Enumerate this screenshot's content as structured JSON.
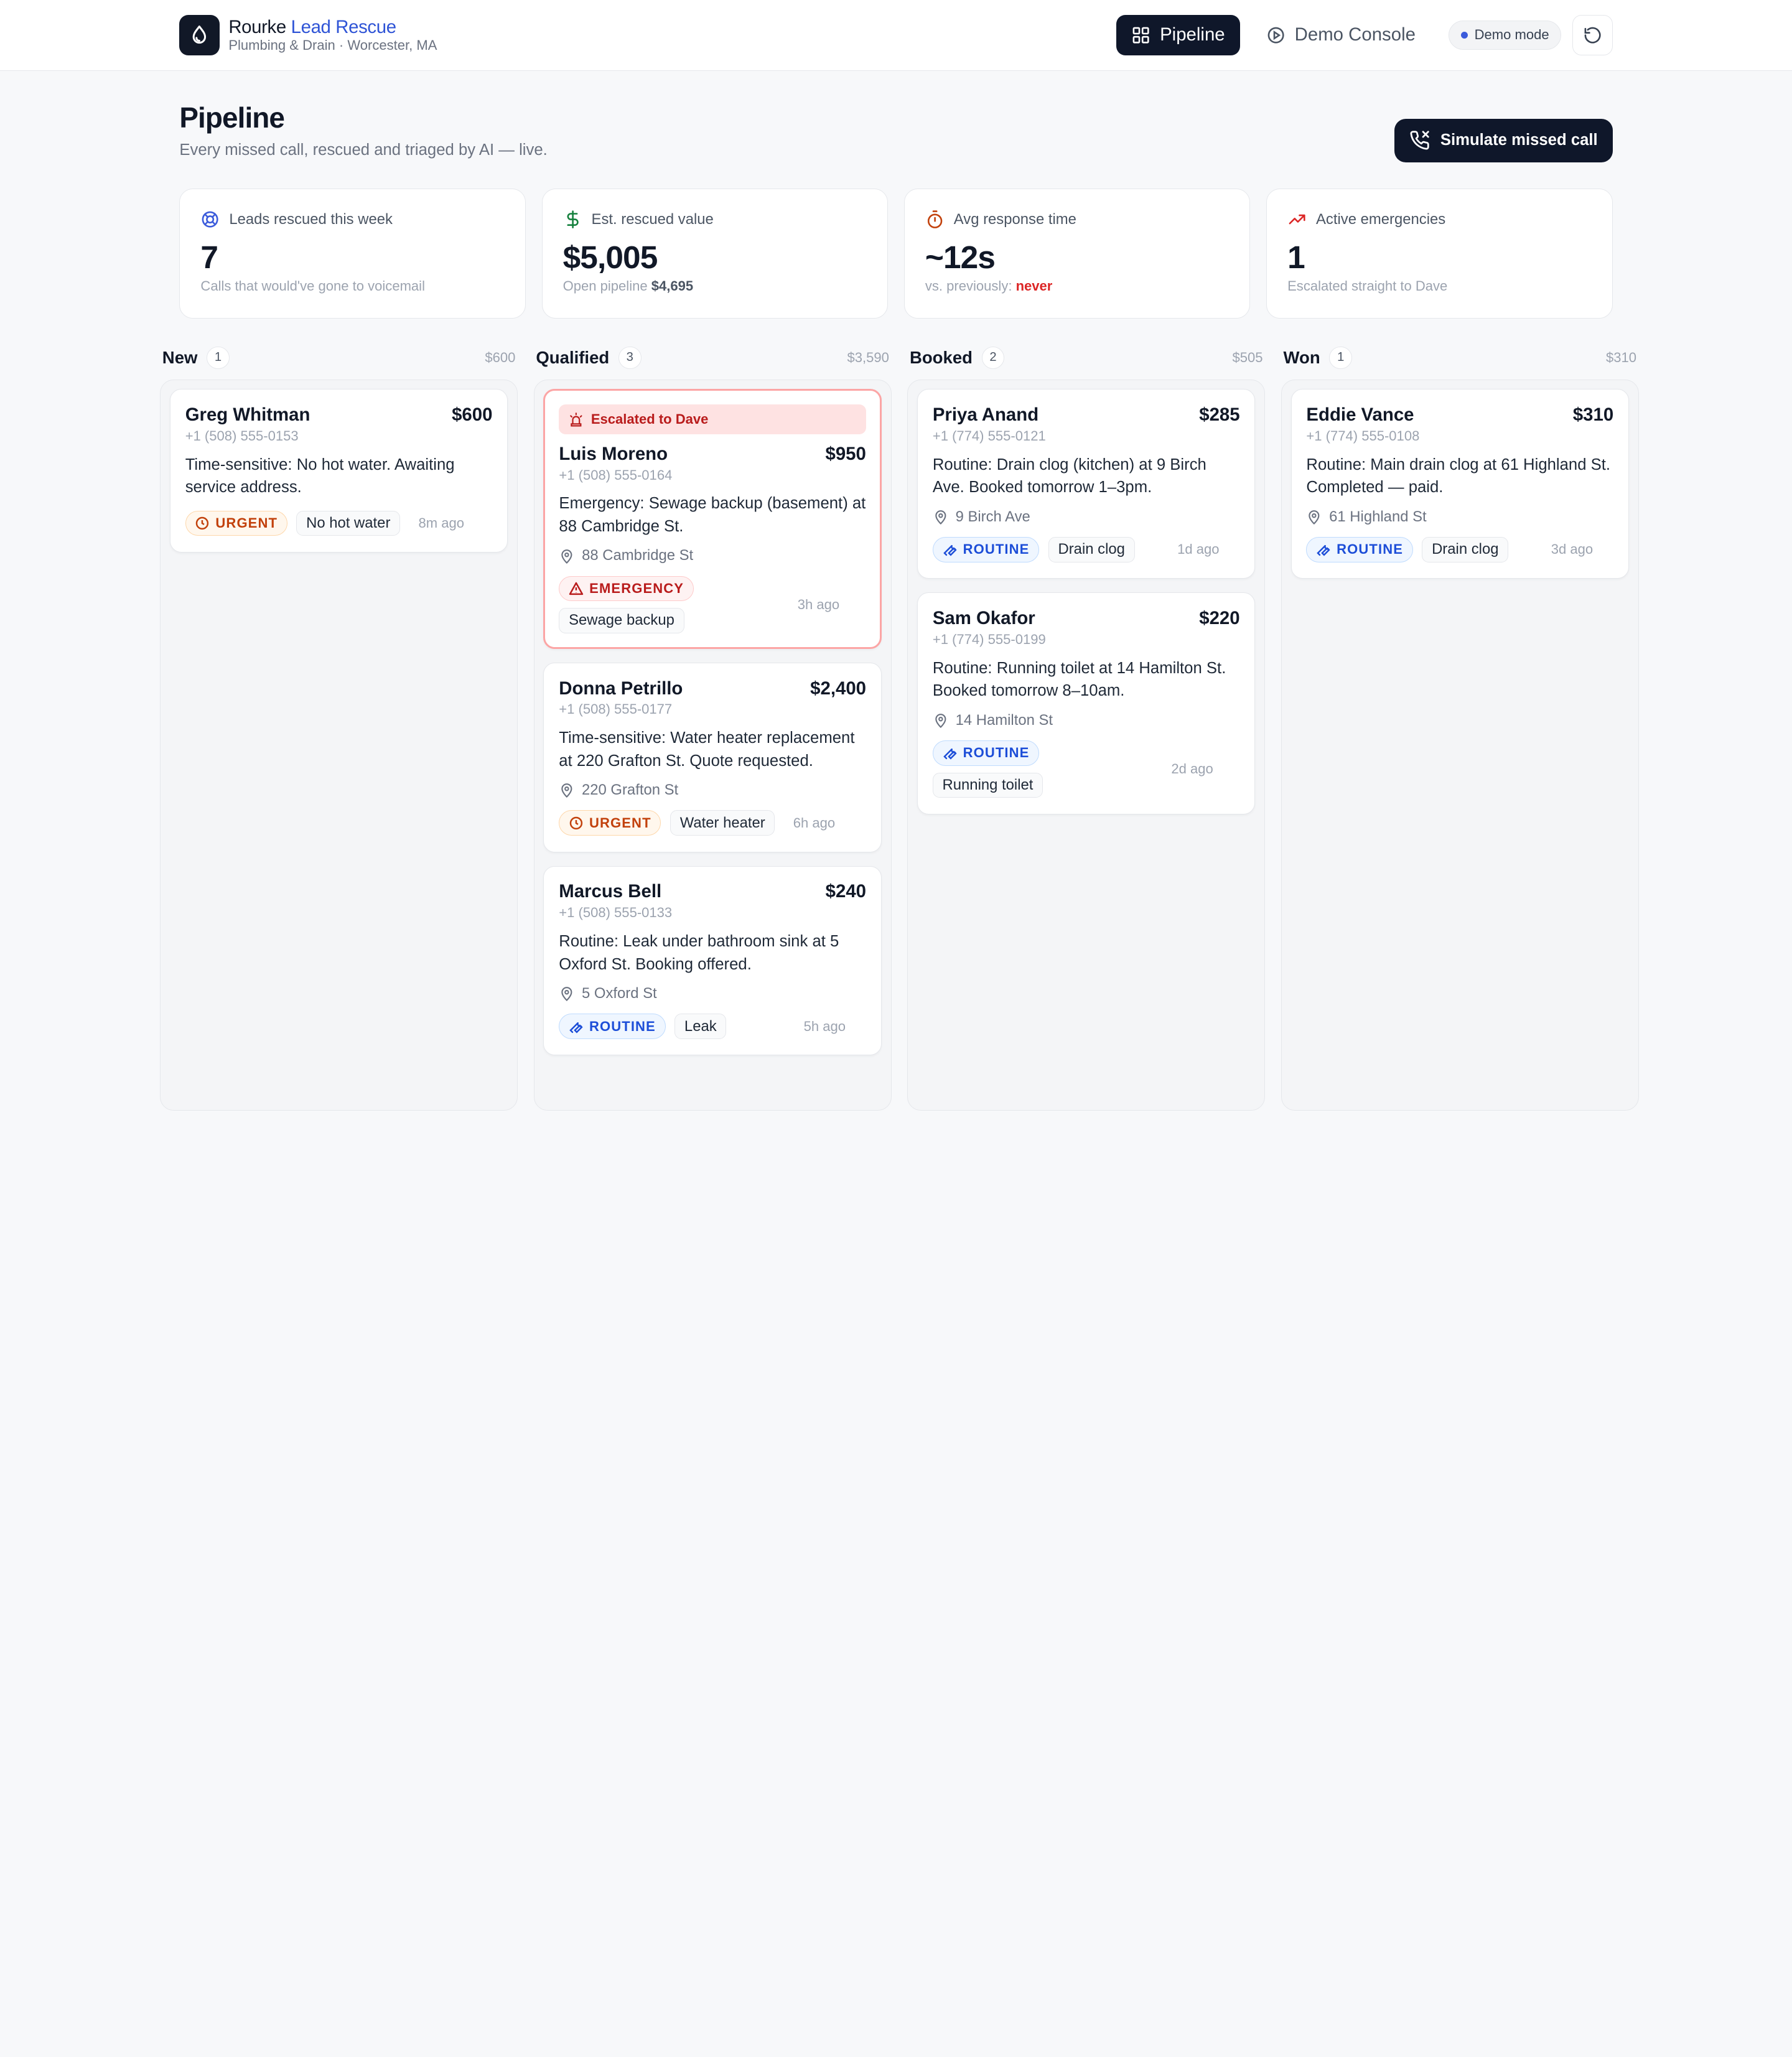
{
  "app": {
    "brand_name": "Rourke",
    "brand_accent": "Lead Rescue",
    "brand_sub": "Plumbing & Drain · Worcester, MA"
  },
  "nav": {
    "pipeline": "Pipeline",
    "demo_console": "Demo Console",
    "demo_mode": "Demo mode"
  },
  "header": {
    "title": "Pipeline",
    "subtitle": "Every missed call, rescued and triaged by AI — live.",
    "simulate_button": "Simulate missed call"
  },
  "stats": [
    {
      "label": "Leads rescued this week",
      "value": "7",
      "note": "Calls that would've gone to voicemail",
      "icon": "life-ring-icon",
      "color": "#3b5bdb"
    },
    {
      "label": "Est. rescued value",
      "value": "$5,005",
      "note_prefix": "Open pipeline",
      "note_strong": "$4,695",
      "icon": "dollar-icon",
      "color": "#15803d"
    },
    {
      "label": "Avg response time",
      "value": "~12s",
      "note_prefix": "vs. previously:",
      "note_strong": "never",
      "icon": "stopwatch-icon",
      "color": "#c2410c"
    },
    {
      "label": "Active emergencies",
      "value": "1",
      "note": "Escalated straight to Dave",
      "icon": "trending-up-icon",
      "color": "#dc2626"
    }
  ],
  "columns": [
    {
      "title": "New",
      "count": "1",
      "total": "$600",
      "cards": [
        {
          "name": "Greg Whitman",
          "amount": "$600",
          "phone": "+1 (508) 555-0153",
          "desc": "Time-sensitive: No hot water. Awaiting service address.",
          "address": "",
          "badge": "URGENT",
          "badge_type": "urgent",
          "tag": "No hot water",
          "ago": "8m ago"
        }
      ]
    },
    {
      "title": "Qualified",
      "count": "3",
      "total": "$3,590",
      "cards": [
        {
          "escalated": "Escalated to Dave",
          "name": "Luis Moreno",
          "amount": "$950",
          "phone": "+1 (508) 555-0164",
          "desc": "Emergency: Sewage backup (basement) at 88 Cambridge St.",
          "address": "88 Cambridge St",
          "badge": "EMERGENCY",
          "badge_type": "emergency",
          "tag": "Sewage backup",
          "ago": "3h ago"
        },
        {
          "name": "Donna Petrillo",
          "amount": "$2,400",
          "phone": "+1 (508) 555-0177",
          "desc": "Time-sensitive: Water heater replacement at 220 Grafton St. Quote requested.",
          "address": "220 Grafton St",
          "badge": "URGENT",
          "badge_type": "urgent",
          "tag": "Water heater",
          "ago": "6h ago"
        },
        {
          "name": "Marcus Bell",
          "amount": "$240",
          "phone": "+1 (508) 555-0133",
          "desc": "Routine: Leak under bathroom sink at 5 Oxford St. Booking offered.",
          "address": "5 Oxford St",
          "badge": "ROUTINE",
          "badge_type": "routine",
          "tag": "Leak",
          "ago": "5h ago"
        }
      ]
    },
    {
      "title": "Booked",
      "count": "2",
      "total": "$505",
      "cards": [
        {
          "name": "Priya Anand",
          "amount": "$285",
          "phone": "+1 (774) 555-0121",
          "desc": "Routine: Drain clog (kitchen) at 9 Birch Ave. Booked tomorrow 1–3pm.",
          "address": "9 Birch Ave",
          "badge": "ROUTINE",
          "badge_type": "routine",
          "tag": "Drain clog",
          "ago": "1d ago"
        },
        {
          "name": "Sam Okafor",
          "amount": "$220",
          "phone": "+1 (774) 555-0199",
          "desc": "Routine: Running toilet at 14 Hamilton St. Booked tomorrow 8–10am.",
          "address": "14 Hamilton St",
          "badge": "ROUTINE",
          "badge_type": "routine",
          "tag": "Running toilet",
          "ago": "2d ago"
        }
      ]
    },
    {
      "title": "Won",
      "count": "1",
      "total": "$310",
      "cards": [
        {
          "name": "Eddie Vance",
          "amount": "$310",
          "phone": "+1 (774) 555-0108",
          "desc": "Routine: Main drain clog at 61 Highland St. Completed — paid.",
          "address": "61 Highland St",
          "badge": "ROUTINE",
          "badge_type": "routine",
          "tag": "Drain clog",
          "ago": "3d ago"
        }
      ]
    }
  ]
}
